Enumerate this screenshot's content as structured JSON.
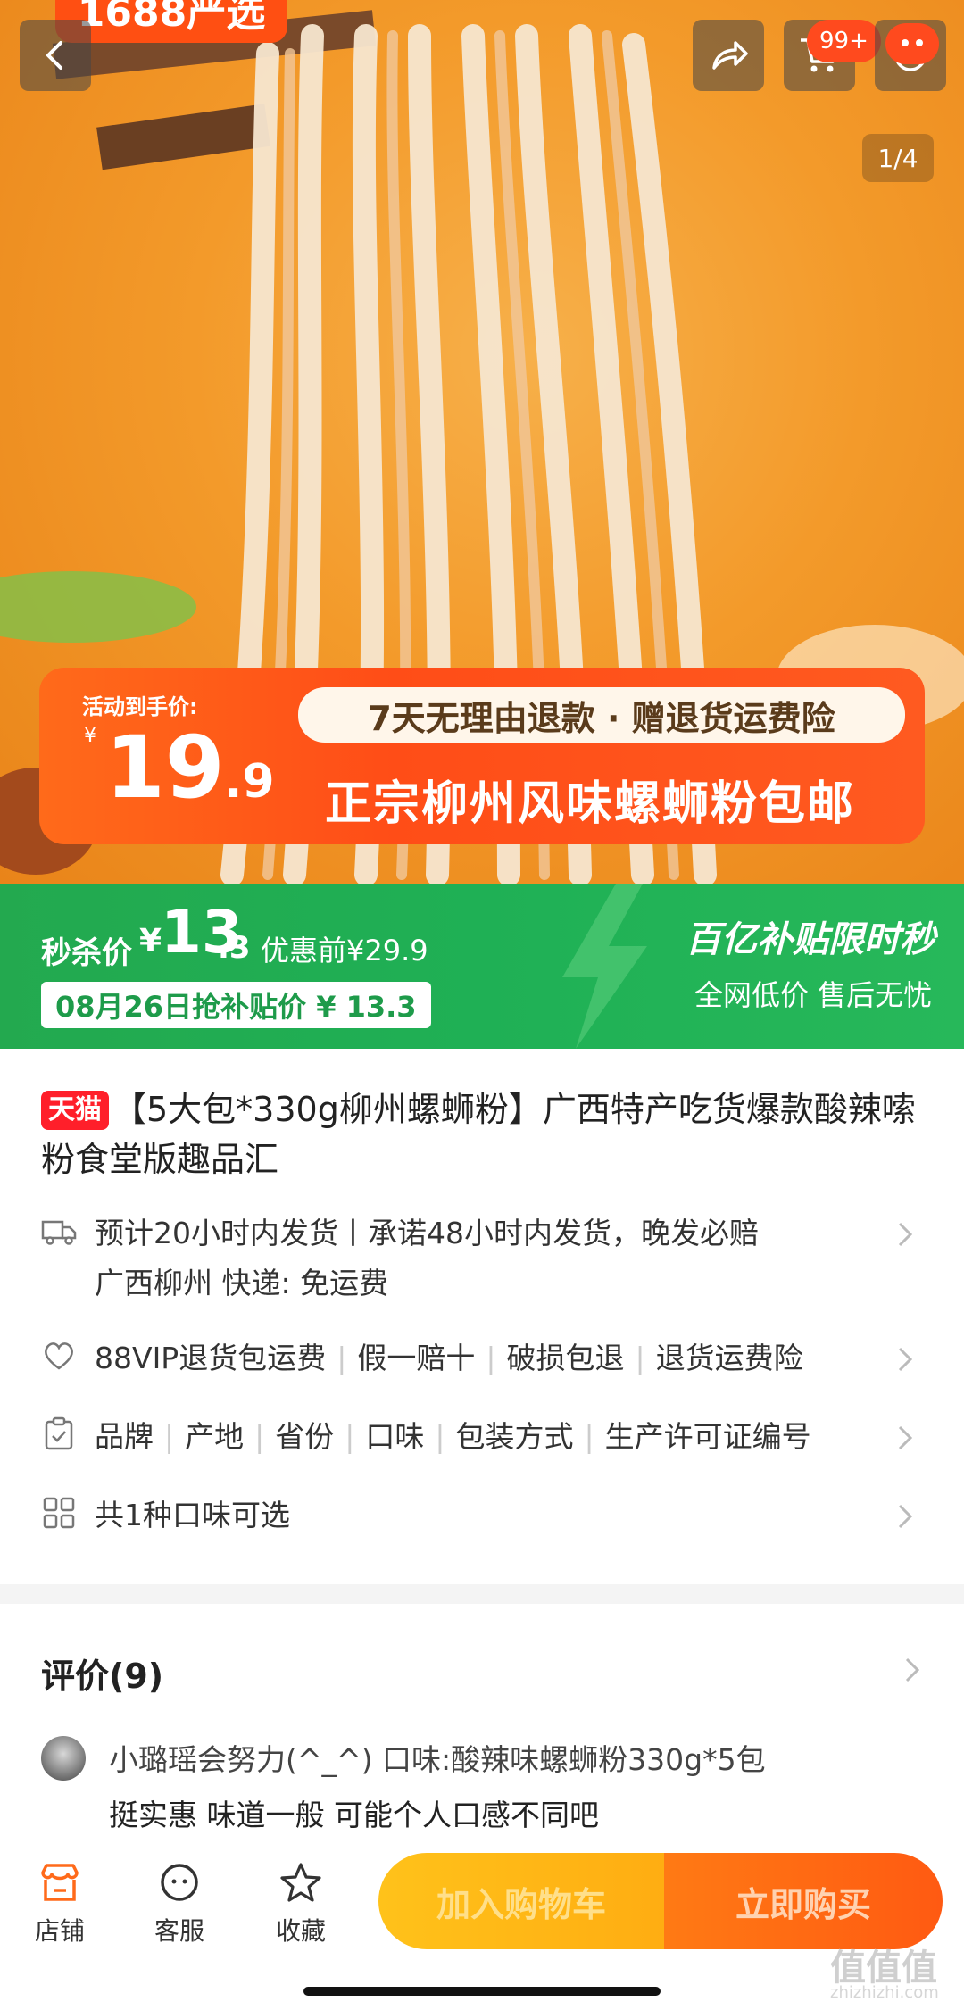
{
  "hero": {
    "store_tag": "1688严选",
    "cart_badge": "99+",
    "image_counter": "1/4",
    "promo": {
      "label": "活动到手价:",
      "currency": "¥",
      "price_int": "19",
      "price_dec": ".9",
      "refund_note": "7天无理由退款 · 赠退货运费险",
      "headline": "正宗柳州风味螺蛳粉包邮"
    }
  },
  "flash_sale": {
    "label": "秒杀价",
    "currency": "¥",
    "price_int": "13",
    "price_dec": ".3",
    "original": "优惠前¥29.9",
    "date_price": "08月26日抢补贴价 ¥ 13.3",
    "slogan": "百亿补贴限时秒",
    "sub": "全网低价 售后无忧"
  },
  "product": {
    "badge": "天猫",
    "title": "【5大包*330g柳州螺蛳粉】广西特产吃货爆款酸辣嗦粉食堂版趣品汇",
    "shipping_line1": "预计20小时内发货丨承诺48小时内发货，晚发必赔",
    "shipping_line2": "广西柳州  快递: 免运费",
    "guarantees": [
      "88VIP退货包运费",
      "假一赔十",
      "破损包退",
      "退货运费险"
    ],
    "params": [
      "品牌",
      "产地",
      "省份",
      "口味",
      "包装方式",
      "生产许可证编号"
    ],
    "options": "共1种口味可选"
  },
  "reviews": {
    "header": "评价(9)",
    "user_line": "小璐瑶会努力(^_^)  口味:酸辣味螺蛳粉330g*5包",
    "text": "挺实惠  味道一般 可能个人口感不同吧"
  },
  "bottom_bar": {
    "shop": "店铺",
    "service": "客服",
    "favorite": "收藏",
    "add_cart": "加入购物车",
    "buy_now": "立即购买"
  },
  "watermark": {
    "main": "值值值",
    "sub": "zhizhizhi.com"
  },
  "colors": {
    "accent_orange": "#ff5a12",
    "flash_green": "#23a94f",
    "tmall_red": "#ff1f2a"
  }
}
